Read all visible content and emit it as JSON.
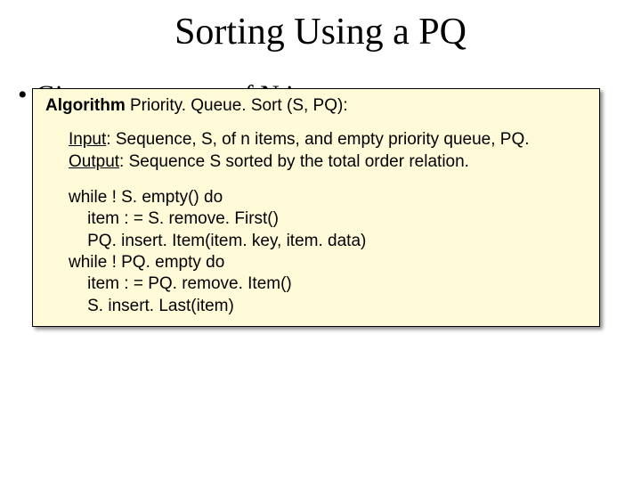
{
  "title": "Sorting Using a PQ",
  "bullet": {
    "dot": "•",
    "text": "Given a sequence of N items"
  },
  "algo": {
    "keyword": "Algorithm",
    "signature": " Priority. Queue. Sort (S, PQ):",
    "input_label": "Input",
    "input_text": ": Sequence, S, of n items, and empty priority queue, PQ.",
    "output_label": "Output",
    "output_text": ": Sequence S sorted by the total order relation.",
    "code": "while ! S. empty() do\n    item : = S. remove. First()\n    PQ. insert. Item(item. key, item. data)\nwhile ! PQ. empty do\n    item : = PQ. remove. Item()\n    S. insert. Last(item)"
  }
}
